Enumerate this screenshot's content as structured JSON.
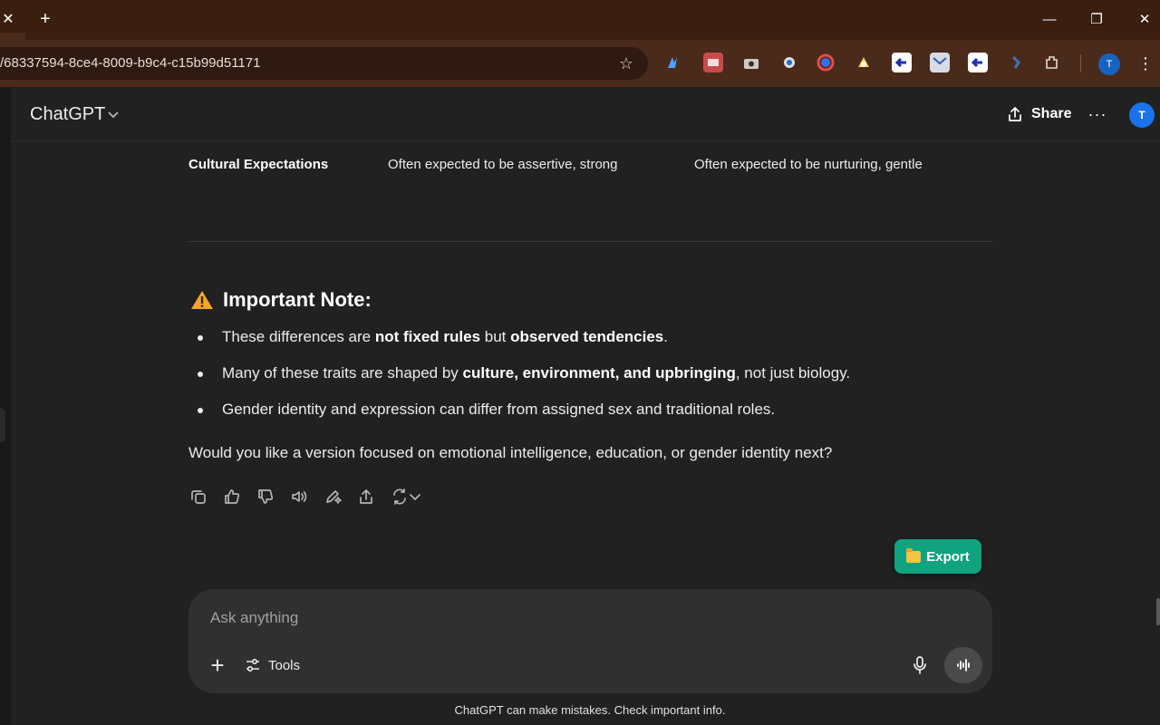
{
  "browser": {
    "tab_close": "✕",
    "new_tab": "+",
    "url": "/68337594-8ce4-8009-b9c4-c15b99d51171",
    "profile_initial": "T",
    "window_controls": [
      "—",
      "❐",
      "✕"
    ]
  },
  "header": {
    "model_name": "ChatGPT",
    "model_chevron": "⌄",
    "share_label": "Share",
    "more_label": "···",
    "avatar_initial": "T"
  },
  "table": {
    "row": [
      "Cultural Expectations",
      "Often expected to be assertive, strong",
      "Often expected to be nurturing, gentle"
    ]
  },
  "note": {
    "title": "Important Note:",
    "bullets": [
      {
        "pre": "These differences are ",
        "b1": "not fixed rules",
        "mid": " but ",
        "b2": "observed tendencies",
        "post": "."
      },
      {
        "pre": "Many of these traits are shaped by ",
        "b1": "culture, environment, and upbringing",
        "post": ", not just biology."
      },
      {
        "text": "Gender identity and expression can differ from assigned sex and traditional roles."
      }
    ],
    "followup": "Would you like a version focused on emotional intelligence, education, or gender identity next?"
  },
  "export_label": "Export",
  "composer": {
    "placeholder": "Ask anything",
    "plus_label": "+",
    "tools_label": "Tools"
  },
  "disclaimer": "ChatGPT can make mistakes. Check important info.",
  "colors": {
    "background": "#212121",
    "accent_export": "#10a37f",
    "tabbar": "#3a1f10",
    "toolbar": "#4a2a1a"
  }
}
